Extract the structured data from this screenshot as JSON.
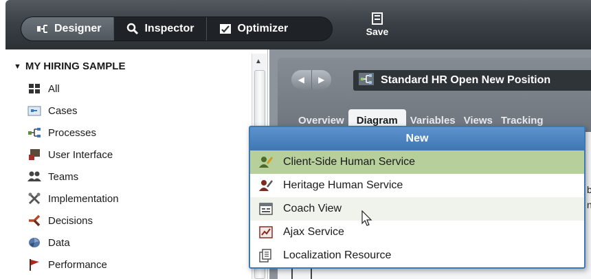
{
  "toolbar": {
    "modes": [
      {
        "label": "Designer",
        "icon": "designer-icon",
        "active": true
      },
      {
        "label": "Inspector",
        "icon": "search-icon",
        "active": false
      },
      {
        "label": "Optimizer",
        "icon": "optimizer-icon",
        "active": false
      }
    ],
    "save_label": "Save"
  },
  "sidebar": {
    "header": "MY HIRING SAMPLE",
    "items": [
      {
        "label": "All",
        "icon": "grid-icon"
      },
      {
        "label": "Cases",
        "icon": "cases-icon"
      },
      {
        "label": "Processes",
        "icon": "processes-icon"
      },
      {
        "label": "User Interface",
        "icon": "user-interface-icon"
      },
      {
        "label": "Teams",
        "icon": "teams-icon"
      },
      {
        "label": "Implementation",
        "icon": "implementation-icon"
      },
      {
        "label": "Decisions",
        "icon": "decisions-icon"
      },
      {
        "label": "Data",
        "icon": "data-icon"
      },
      {
        "label": "Performance",
        "icon": "performance-flag-icon"
      }
    ]
  },
  "editor": {
    "title": "Standard HR Open New Position",
    "tabs": [
      {
        "label": "Overview",
        "active": false
      },
      {
        "label": "Diagram",
        "active": true
      },
      {
        "label": "Variables",
        "active": false
      },
      {
        "label": "Views",
        "active": false
      },
      {
        "label": "Tracking",
        "active": false
      }
    ],
    "peek": [
      "b",
      "n"
    ]
  },
  "popup": {
    "header": "New",
    "items": [
      {
        "label": "Client-Side Human Service",
        "icon": "client-side-human-service-icon",
        "state": "selected"
      },
      {
        "label": "Heritage Human Service",
        "icon": "heritage-human-service-icon",
        "state": "normal"
      },
      {
        "label": "Coach View",
        "icon": "coach-view-icon",
        "state": "hover"
      },
      {
        "label": "Ajax Service",
        "icon": "ajax-service-icon",
        "state": "normal"
      },
      {
        "label": "Localization Resource",
        "icon": "localization-resource-icon",
        "state": "normal"
      }
    ]
  },
  "colors": {
    "toolbar_bg": "#3b4147",
    "popup_header": "#4a84c1",
    "selected_row": "#b7cf9b"
  }
}
